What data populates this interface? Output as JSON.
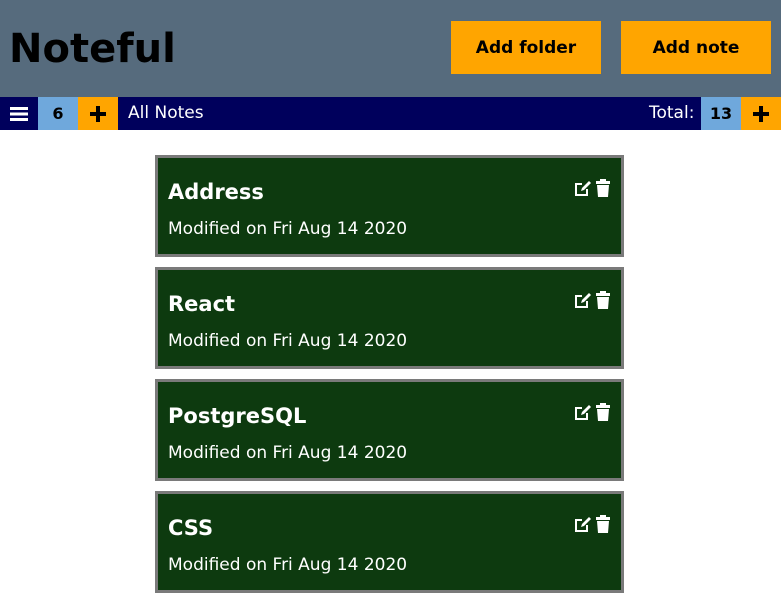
{
  "app": {
    "title": "Noteful"
  },
  "header": {
    "add_folder_label": "Add folder",
    "add_note_label": "Add note"
  },
  "navbar": {
    "menu_icon": "hamburger-menu-icon",
    "folder_count": "6",
    "plus_icon": "plus-icon",
    "current_label": "All Notes",
    "total_label": "Total:",
    "total_count": "13"
  },
  "notes": [
    {
      "title": "Address",
      "modified": "Modified on Fri Aug 14 2020"
    },
    {
      "title": "React",
      "modified": "Modified on Fri Aug 14 2020"
    },
    {
      "title": "PostgreSQL",
      "modified": "Modified on Fri Aug 14 2020"
    },
    {
      "title": "CSS",
      "modified": "Modified on Fri Aug 14 2020"
    }
  ],
  "colors": {
    "header_bg": "#566b7d",
    "accent": "#ffa500",
    "navbar_bg": "#00005c",
    "count_bg": "#6fa8dc",
    "note_bg": "#0d3a0f",
    "note_border": "#7a7a7a"
  }
}
